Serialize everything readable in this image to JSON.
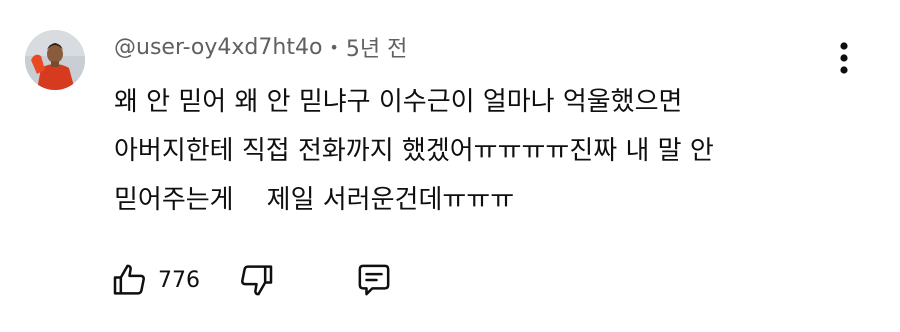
{
  "comment": {
    "avatar_icon": "avatar-photo",
    "author": "@user-oy4xd7ht4o",
    "separator": "•",
    "time_ago": "5년 전",
    "lines": [
      "왜 안 믿어 왜 안 믿냐구 이수근이 얼마나 억울했으면",
      "아버지한테 직접 전화까지 했겠어ㅠㅠㅠㅠ진짜 내 말 안",
      "믿어주는게    제일 서러운건데ㅠㅠㅠ"
    ],
    "like_count": "776",
    "icons": {
      "more": "more-vert-icon",
      "like": "thumbs-up-icon",
      "dislike": "thumbs-down-icon",
      "reply": "comment-icon"
    }
  }
}
